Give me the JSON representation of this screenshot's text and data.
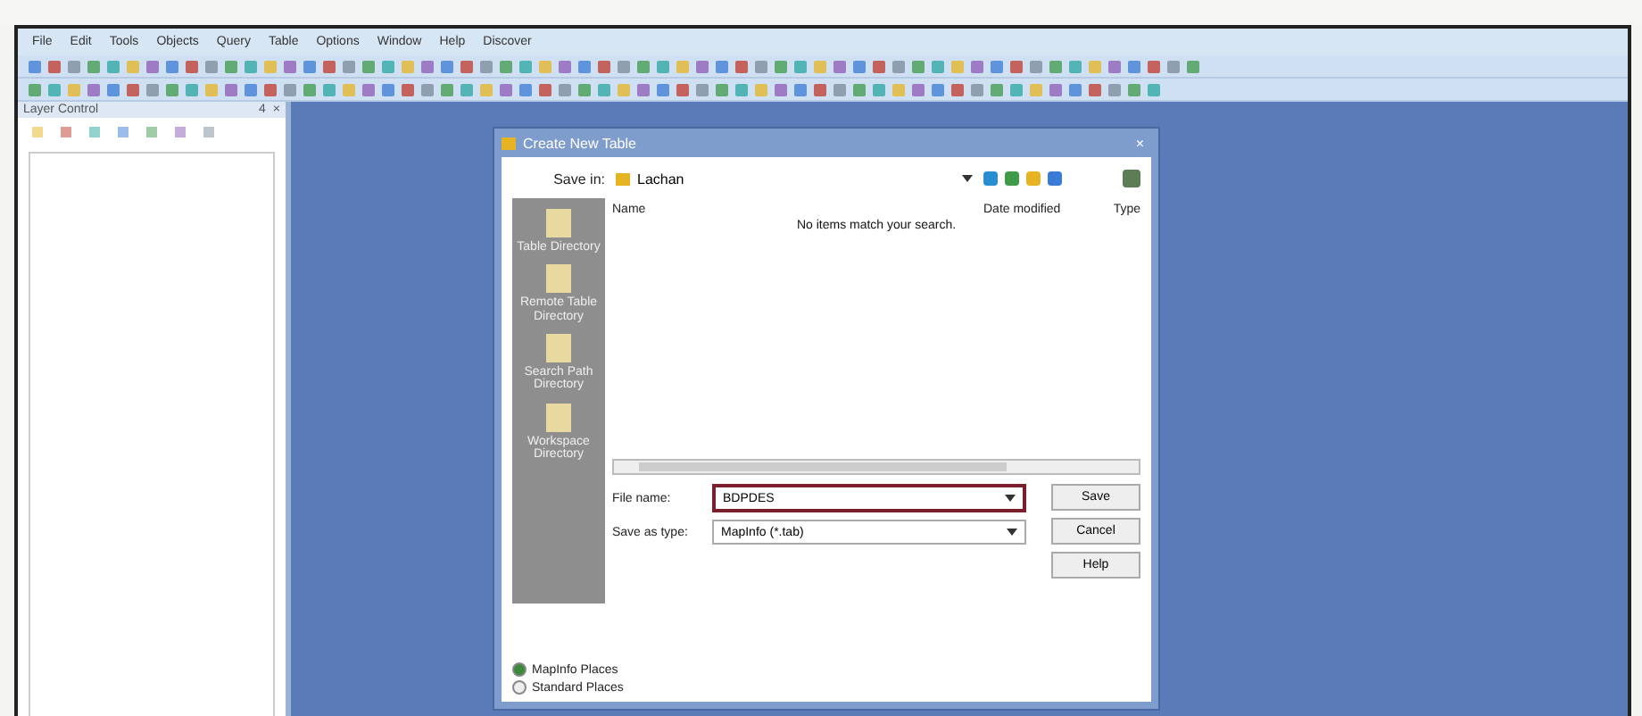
{
  "menu_bar": [
    "File",
    "Edit",
    "Tools",
    "Objects",
    "Query",
    "Table",
    "Options",
    "Window",
    "Help",
    "Discover"
  ],
  "layer_control": {
    "title": "Layer Control",
    "pin": "4",
    "close": "×"
  },
  "dialog": {
    "title": "Create New Table",
    "close": "×",
    "save_in_label": "Save in:",
    "save_in_value": "Lachan",
    "places": [
      {
        "label": "Table Directory"
      },
      {
        "label": "Remote Table Directory"
      },
      {
        "label": "Search Path Directory"
      },
      {
        "label": "Workspace Directory"
      }
    ],
    "columns": [
      "Name",
      "Date modified",
      "Type"
    ],
    "empty_message": "No items match your search.",
    "file_name_label": "File name:",
    "file_name_value": "BDPDES",
    "save_type_label": "Save as type:",
    "save_type_value": "MapInfo (*.tab)",
    "buttons": [
      "Save",
      "Cancel",
      "Help"
    ],
    "place_modes": [
      {
        "label": "MapInfo Places",
        "selected": true
      },
      {
        "label": "Standard Places",
        "selected": false
      }
    ]
  }
}
